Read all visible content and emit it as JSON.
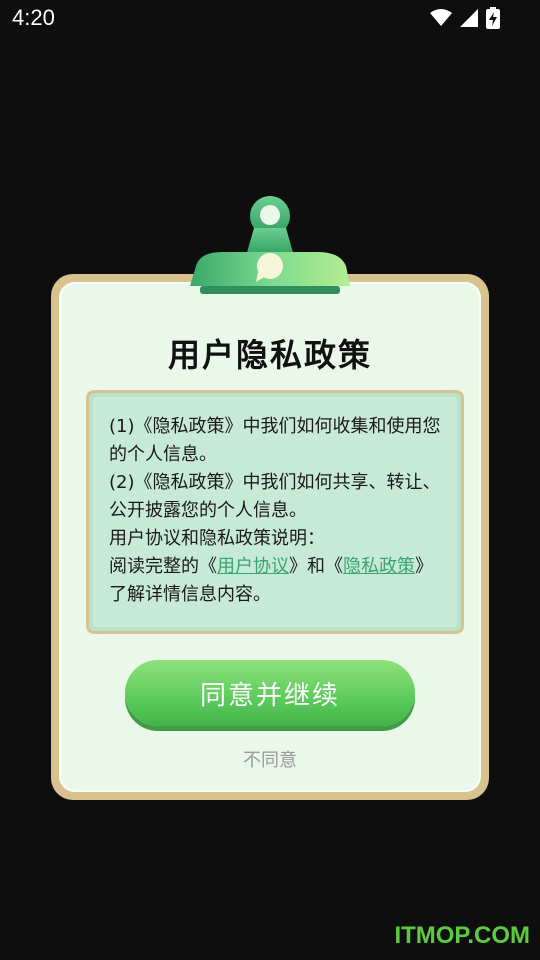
{
  "status_bar": {
    "time": "4:20"
  },
  "dialog": {
    "title": "用户隐私政策",
    "lines": [
      "(1)《隐私政策》中我们如何收集和使用您的个人信息。",
      "(2)《隐私政策》中我们如何共享、转让、公开披露您的个人信息。",
      "用户协议和隐私政策说明："
    ],
    "read_prefix": "阅读完整的《",
    "user_agreement_link": "用户协议",
    "and_text": "》和《",
    "privacy_policy_link": "隐私政策",
    "read_suffix": "》了解详情信息内容。",
    "agree_button": "同意并继续",
    "disagree_button": "不同意"
  },
  "watermark": "ITMOP.COM",
  "colors": {
    "background": "#0e0e0e",
    "card_border": "#d8c38e",
    "card_fill": "#e9f8e9",
    "content_fill": "#c7e9d7",
    "button_green": "#5ccb5c",
    "link_green": "#3aa56f"
  },
  "icons": [
    "wifi-icon",
    "cellular-signal-icon",
    "battery-charging-icon",
    "clipboard-clip-icon",
    "chat-bubble-icon"
  ]
}
